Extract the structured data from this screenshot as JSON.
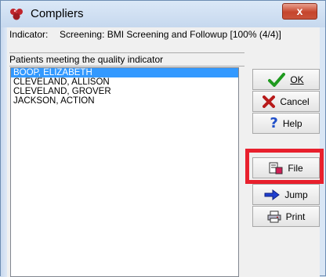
{
  "window": {
    "title": "Compliers",
    "close_label": "x"
  },
  "header": {
    "indicator_label": "Indicator:",
    "indicator_value": "Screening: BMI Screening and Followup [100% (4/4)]",
    "patients_label": "Patients meeting the quality indicator"
  },
  "patients": [
    {
      "name": "BOOP, ELIZABETH",
      "selected": true
    },
    {
      "name": "CLEVELAND, ALLISON",
      "selected": false
    },
    {
      "name": "CLEVELAND, GROVER",
      "selected": false
    },
    {
      "name": "JACKSON, ACTION",
      "selected": false
    }
  ],
  "buttons": {
    "ok": "OK",
    "cancel": "Cancel",
    "help": "Help",
    "file": "File",
    "jump": "Jump",
    "print": "Print"
  },
  "colors": {
    "selection": "#3399ff",
    "highlight_box": "#e8202d",
    "close_button": "#c6452c"
  }
}
